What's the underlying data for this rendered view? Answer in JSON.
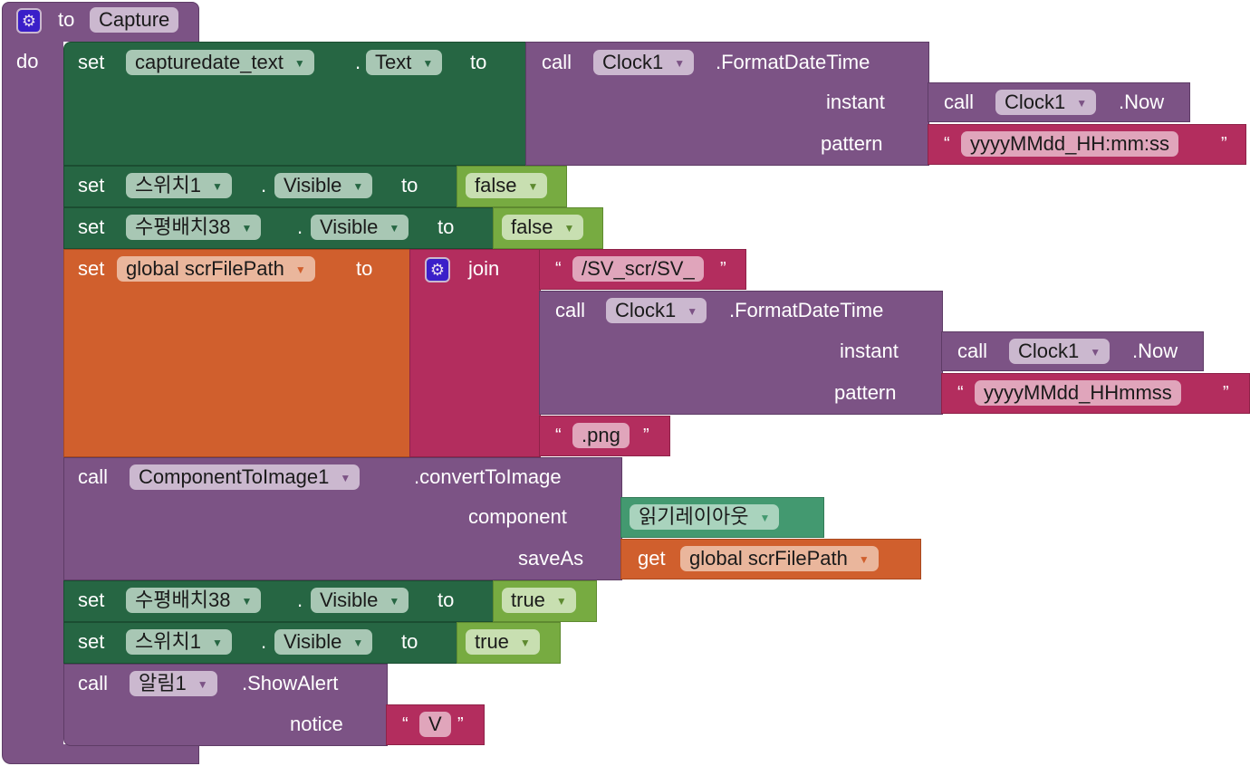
{
  "procedure": {
    "keyword_to": "to",
    "name": "Capture",
    "keyword_do": "do"
  },
  "blocks": {
    "s1": {
      "set": "set",
      "component": "capturedate_text",
      "dot": ".",
      "property": "Text",
      "to": "to",
      "call": "call",
      "clock": "Clock1",
      "method": ".FormatDateTime",
      "instant": "instant",
      "pattern": "pattern",
      "now_call": "call",
      "now_clock": "Clock1",
      "now_method": ".Now",
      "pattern_value": "yyyyMMdd_HH:mm:ss"
    },
    "s2": {
      "set": "set",
      "component": "스위치1",
      "dot": ".",
      "property": "Visible",
      "to": "to",
      "value": "false"
    },
    "s3": {
      "set": "set",
      "component": "수평배치38",
      "dot": ".",
      "property": "Visible",
      "to": "to",
      "value": "false"
    },
    "s4": {
      "set": "set",
      "variable": "global scrFilePath",
      "to": "to",
      "join": "join",
      "str1": "/SV_scr/SV_",
      "call": "call",
      "clock": "Clock1",
      "method": ".FormatDateTime",
      "instant": "instant",
      "pattern": "pattern",
      "now_call": "call",
      "now_clock": "Clock1",
      "now_method": ".Now",
      "pattern_value": "yyyyMMdd_HHmmss",
      "str3": ".png"
    },
    "s5": {
      "call": "call",
      "component": "ComponentToImage1",
      "method": ".convertToImage",
      "component_label": "component",
      "component_value": "읽기레이아웃",
      "saveas_label": "saveAs",
      "get": "get",
      "get_variable": "global scrFilePath"
    },
    "s6": {
      "set": "set",
      "component": "수평배치38",
      "dot": ".",
      "property": "Visible",
      "to": "to",
      "value": "true"
    },
    "s7": {
      "set": "set",
      "component": "스위치1",
      "dot": ".",
      "property": "Visible",
      "to": "to",
      "value": "true"
    },
    "s8": {
      "call": "call",
      "component": "알림1",
      "method": ".ShowAlert",
      "notice": "notice",
      "notice_value": "V"
    }
  },
  "quote_open": "“",
  "quote_close": "”",
  "dropdown_arrow": "▼"
}
